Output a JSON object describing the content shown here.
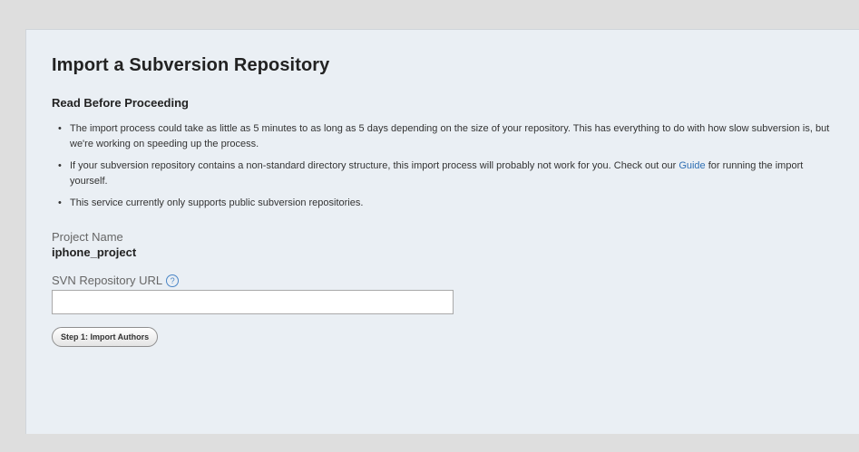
{
  "page": {
    "title": "Import a Subversion Repository"
  },
  "notice": {
    "heading": "Read Before Proceeding",
    "items": [
      {
        "text": "The import process could take as little as 5 minutes to as long as 5 days depending on the size of your repository. This has everything to do with how slow subversion is, but we're working on speeding up the process."
      },
      {
        "text_before": "If your subversion repository contains a non-standard directory structure, this import process will probably not work for you. Check out our ",
        "link_label": "Guide",
        "text_after": " for running the import yourself."
      },
      {
        "text": "This service currently only supports public subversion repositories."
      }
    ]
  },
  "form": {
    "project_name_label": "Project Name",
    "project_name_value": "iphone_project",
    "svn_url_label": "SVN Repository URL",
    "svn_url_value": "",
    "help_icon_glyph": "?",
    "submit_label": "Step 1: Import Authors"
  },
  "colors": {
    "panel_background": "#eaeff4",
    "outer_background": "#dedede",
    "link": "#2f6fb3"
  }
}
